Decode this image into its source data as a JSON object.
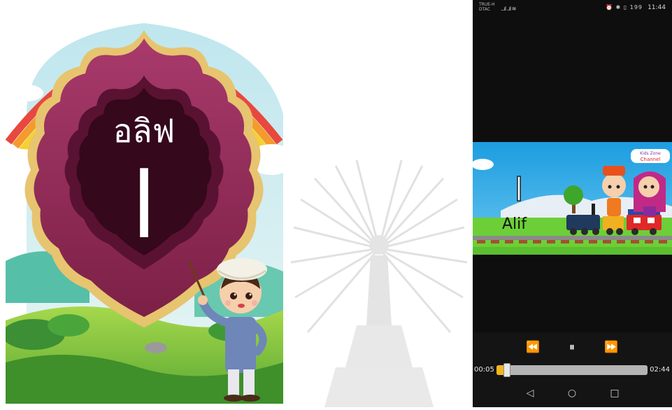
{
  "card": {
    "title_thai": "อลิฟ",
    "letter": "ا"
  },
  "phone": {
    "status": {
      "carrier_line1": "TRUE-H",
      "carrier_line2": "DTAC",
      "signal": "...ıl ..ıl ≋",
      "icons": "⏰ ✱ ▯ 199",
      "time": "11:44"
    },
    "video": {
      "caption": "Alif",
      "arabic_letter": "ا",
      "channel_logo_line1": "Kids Zone",
      "channel_logo_line2": "Channel"
    },
    "player": {
      "current_time": "00:05",
      "total_time": "02:44",
      "progress": 0.03,
      "rewind_icon": "⏪",
      "pause_icon": "⏸",
      "forward_icon": "⏩"
    },
    "nav": {
      "back_icon": "◁",
      "home_icon": "○",
      "recents_icon": "□"
    }
  }
}
